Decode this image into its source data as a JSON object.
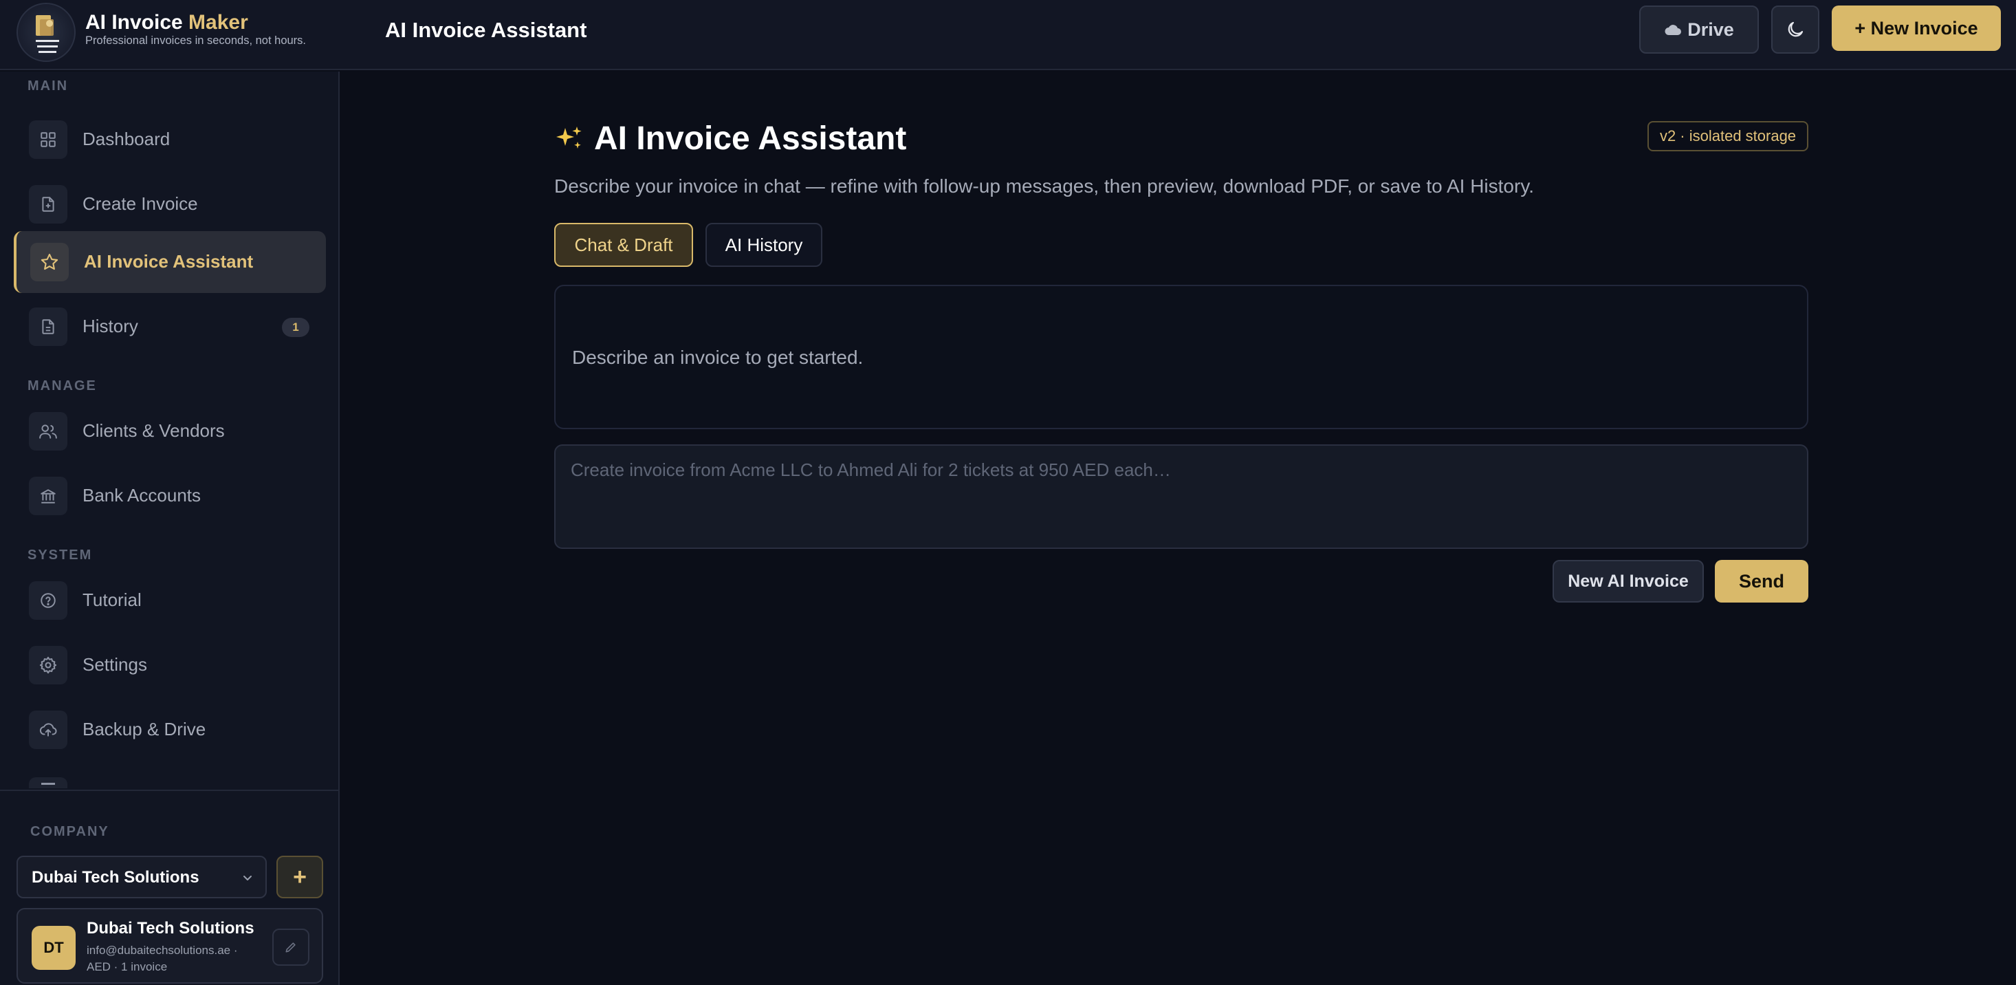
{
  "colors": {
    "accent": "#d9b96a",
    "background": "#0b0e18",
    "sidebar": "#111522"
  },
  "header": {
    "title_main": "AI Invoice ",
    "title_accent": "Maker",
    "subtitle": "Professional invoices in seconds, not hours.",
    "page_title": "AI Invoice Assistant",
    "drive_label": "Drive",
    "new_invoice_label": "+ New Invoice",
    "icons": [
      "logo-icon",
      "cloud-icon",
      "moon-icon"
    ]
  },
  "sidebar": {
    "sections": {
      "main": "MAIN",
      "manage": "MANAGE",
      "system": "SYSTEM",
      "company": "COMPANY"
    },
    "items": [
      {
        "label": "Dashboard",
        "icon": "grid-icon"
      },
      {
        "label": "Create Invoice",
        "icon": "file-plus-icon"
      },
      {
        "label": "AI Invoice Assistant",
        "icon": "star-icon",
        "active": true
      },
      {
        "label": "History",
        "icon": "document-icon",
        "badge": "1"
      },
      {
        "label": "Clients & Vendors",
        "icon": "users-icon"
      },
      {
        "label": "Bank Accounts",
        "icon": "bank-icon"
      },
      {
        "label": "Tutorial",
        "icon": "help-circle-icon"
      },
      {
        "label": "Settings",
        "icon": "gear-icon"
      },
      {
        "label": "Backup & Drive",
        "icon": "cloud-upload-icon"
      }
    ],
    "company": {
      "selected": "Dubai Tech Solutions",
      "add_label": "+",
      "card": {
        "initials": "DT",
        "name": "Dubai Tech Solutions",
        "email": "info@dubaitechsolutions.ae ·",
        "meta": "AED · 1 invoice"
      }
    }
  },
  "main": {
    "title_emoji": "✨",
    "title": "AI Invoice Assistant",
    "version_badge": "v2 · isolated storage",
    "description": "Describe your invoice in chat — refine with follow-up messages, then preview, download PDF, or save to AI History.",
    "tabs": [
      {
        "label": "Chat & Draft",
        "active": true
      },
      {
        "label": "AI History",
        "active": false
      }
    ],
    "chat_empty_text": "Describe an invoice to get started.",
    "prompt_placeholder": "Create invoice from Acme LLC to Ahmed Ali for 2 tickets at 950 AED each…",
    "new_ai_invoice_label": "New AI Invoice",
    "send_label": "Send"
  }
}
